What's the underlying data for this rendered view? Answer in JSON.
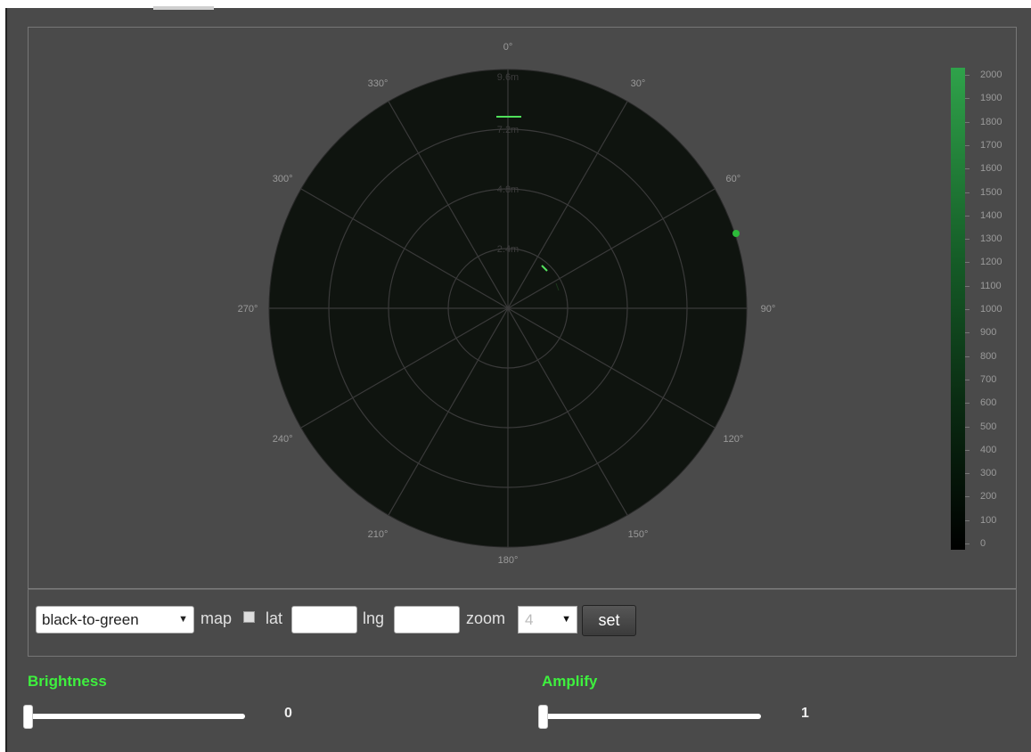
{
  "radar": {
    "angle_labels": [
      "0°",
      "30°",
      "60°",
      "90°",
      "120°",
      "150°",
      "180°",
      "210°",
      "240°",
      "270°",
      "300°",
      "330°"
    ],
    "range_labels": [
      "2.4m",
      "4.8m",
      "7.2m",
      "9.6m"
    ]
  },
  "colors": {
    "background": "#4a4a4a",
    "radar_fill": "#0f140f",
    "grid": "#3a3a3a",
    "accent_green": "#3ef03e",
    "scale_green": "#2fa24a"
  },
  "scale": {
    "labels": [
      "2000",
      "1900",
      "1800",
      "1700",
      "1600",
      "1500",
      "1400",
      "1300",
      "1200",
      "1100",
      "1000",
      "900",
      "800",
      "700",
      "600",
      "500",
      "400",
      "300",
      "200",
      "100",
      "0"
    ]
  },
  "controls": {
    "palette_value": "black-to-green",
    "map_label": "map",
    "lat_label": "lat",
    "lat_value": "",
    "lng_label": "lng",
    "lng_value": "",
    "zoom_label": "zoom",
    "zoom_value": "4",
    "set_label": "set"
  },
  "brightness": {
    "title": "Brightness",
    "value": "0"
  },
  "amplify": {
    "title": "Amplify",
    "value": "1"
  }
}
